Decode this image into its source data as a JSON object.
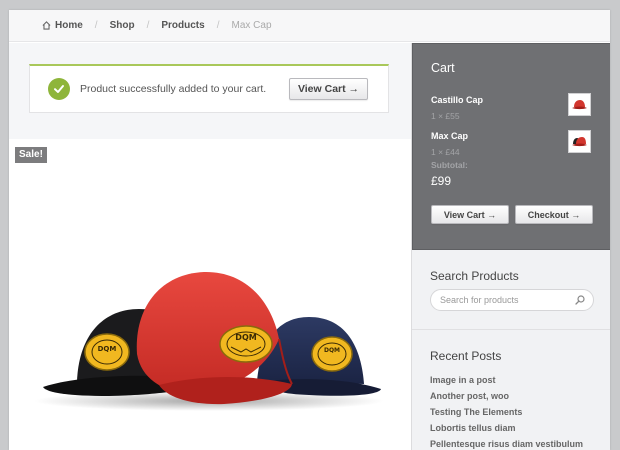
{
  "breadcrumb": {
    "items": [
      "Home",
      "Shop",
      "Products"
    ],
    "current": "Max Cap",
    "separator": "/"
  },
  "notice": {
    "message": "Product successfully added to your cart.",
    "button_label": "View Cart →",
    "accent_color": "#8eb53a"
  },
  "product": {
    "badge": "Sale!",
    "image_alt": "Three DQM snapback caps (black, red, navy)",
    "cap_logo_text": "DQM"
  },
  "cart": {
    "title": "Cart",
    "items": [
      {
        "name": "Castillo Cap",
        "qty": "1 × £55"
      },
      {
        "name": "Max Cap",
        "qty": "1 × £44"
      }
    ],
    "subtotal_label": "Subtotal:",
    "subtotal_value": "£99",
    "view_cart_label": "View Cart →",
    "checkout_label": "Checkout →"
  },
  "search": {
    "title": "Search Products",
    "placeholder": "Search for products"
  },
  "recent_posts": {
    "title": "Recent Posts",
    "items": [
      "Image in a post",
      "Another post, woo",
      "Testing The Elements",
      "Lobortis tellus diam",
      "Pellentesque risus diam vestibulum"
    ]
  }
}
